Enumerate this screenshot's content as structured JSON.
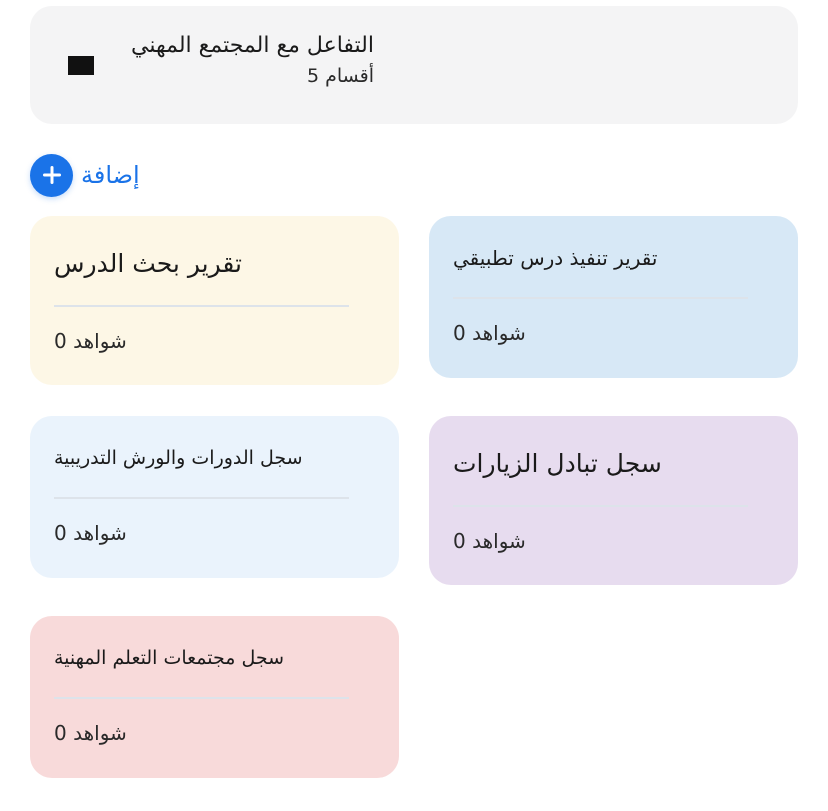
{
  "header": {
    "title": "التفاعل مع المجتمع المهني",
    "subtitle": "أقسام 5",
    "icon": "section-icon"
  },
  "add": {
    "label": "إضافة",
    "icon": "plus-icon",
    "color": "#1a73e8"
  },
  "cards": [
    {
      "title": "تقرير تنفيذ درس تطبيقي",
      "count_label": "شواهد 0",
      "bg": "#d7e8f6"
    },
    {
      "title": "تقرير بحث الدرس",
      "count_label": "شواهد 0",
      "bg": "#fdf7e6"
    },
    {
      "title": "سجل تبادل الزيارات",
      "count_label": "شواهد 0",
      "bg": "#e7dcef"
    },
    {
      "title": "سجل الدورات والورش التدريبية",
      "count_label": "شواهد 0",
      "bg": "#eaf3fc"
    },
    {
      "title": "سجل مجتمعات التعلم المهنية",
      "count_label": "شواهد 0",
      "bg": "#f8dada"
    }
  ]
}
